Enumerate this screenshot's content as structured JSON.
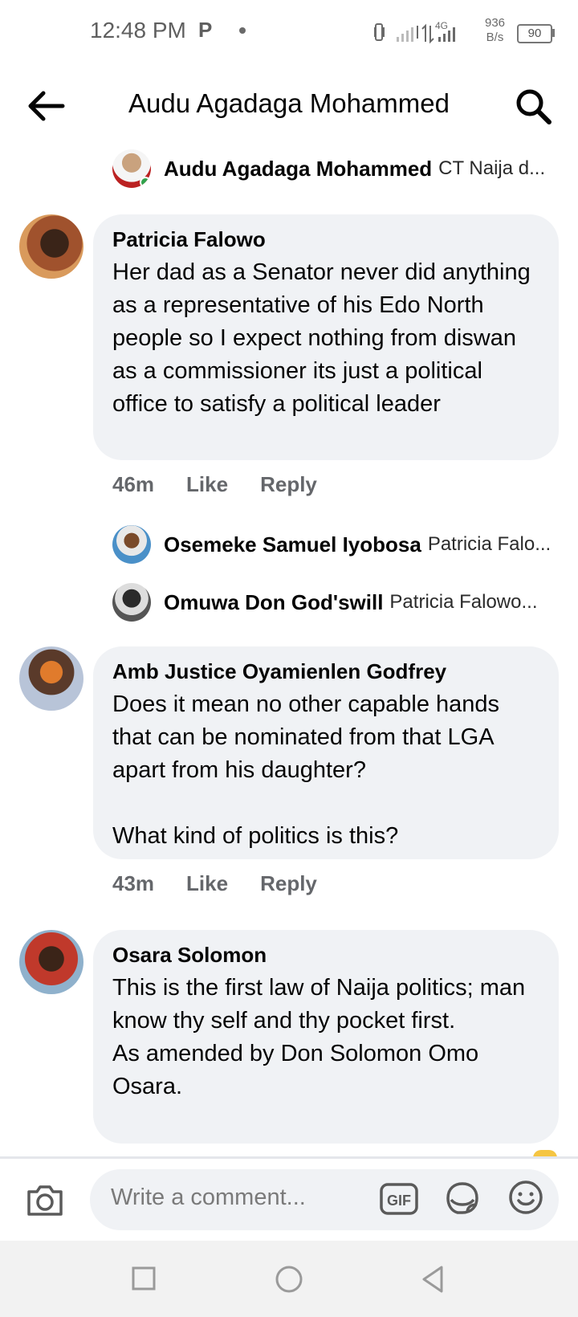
{
  "status_bar": {
    "time": "12:48 PM",
    "app_indicator": "P",
    "net_speed_value": "936",
    "net_speed_unit": "B/s",
    "network_label": "4G",
    "battery": "90"
  },
  "header": {
    "title": "Audu Agadaga Mohammed",
    "back_icon": "arrow-left-icon",
    "search_icon": "search-icon"
  },
  "top_reply": {
    "name": "Audu Agadaga Mohammed",
    "snippet": "CT Naija d..."
  },
  "comments": [
    {
      "author": "Patricia Falowo",
      "text": "Her dad as a Senator never did anything as a representative of his Edo North people so I expect nothing from diswan as a commissioner its just a political office to satisfy a political leader",
      "time": "46m",
      "like": "Like",
      "reply": "Reply",
      "replies": [
        {
          "name": "Osemeke Samuel Iyobosa",
          "snippet": "Patricia Falo..."
        },
        {
          "name": "Omuwa Don God'swill",
          "snippet": "Patricia Falowo..."
        }
      ]
    },
    {
      "author": "Amb Justice Oyamienlen Godfrey",
      "text": "Does it mean no other capable hands that can be nominated from that LGA apart from his daughter?\n\nWhat kind of politics is this?",
      "time": "43m",
      "like": "Like",
      "reply": "Reply"
    },
    {
      "author": "Osara Solomon",
      "text": "This is the first law of Naija politics; man know thy self and thy pocket first.\nAs amended by Don Solomon Omo Osara."
    }
  ],
  "composer": {
    "placeholder": "Write a comment...",
    "camera_icon": "camera-icon",
    "gif_label": "GIF",
    "sticker_icon": "sticker-icon",
    "emoji_icon": "emoji-icon"
  },
  "nav": {
    "recents_icon": "square-icon",
    "home_icon": "circle-icon",
    "back_icon": "triangle-back-icon"
  }
}
